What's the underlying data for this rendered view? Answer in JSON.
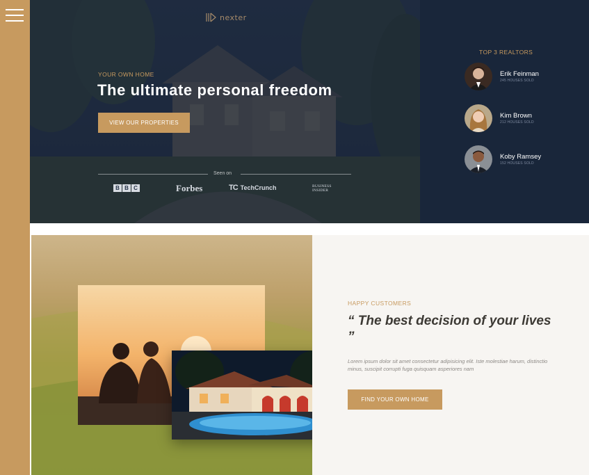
{
  "nav": {
    "menu_icon": "hamburger-menu-icon"
  },
  "brand": {
    "logo_text": "nexter"
  },
  "hero": {
    "eyebrow": "YOUR OWN HOME",
    "title": "The ultimate personal freedom",
    "cta_label": "VIEW OUR PROPERTIES",
    "seen_on_label": "Seen on",
    "press": {
      "bbc": [
        "B",
        "B",
        "C"
      ],
      "forbes": "Forbes",
      "techcrunch_mark": "TC",
      "techcrunch": "TechCrunch",
      "business_insider": [
        "BUSINESS",
        "INSIDER"
      ]
    }
  },
  "realtors": {
    "title": "TOP 3 REALTORS",
    "items": [
      {
        "name": "Erik Feinman",
        "sub": "245 HOUSES SOLD"
      },
      {
        "name": "Kim Brown",
        "sub": "212 HOUSES SOLD"
      },
      {
        "name": "Koby Ramsey",
        "sub": "152 HOUSES SOLD"
      }
    ]
  },
  "testimonial": {
    "eyebrow": "HAPPY CUSTOMERS",
    "quote": "“ The best decision of your lives ”",
    "body": "Lorem ipsum dolor sit amet consectetur adipisicing elit. Iste molestiae harum, distinctio minus, suscipit corrupti fuga quisquam asperiores nam",
    "cta_label": "FIND YOUR OWN HOME"
  },
  "colors": {
    "accent": "#c79a5f",
    "navy": "#19263a",
    "light_bg": "#f7f5f2"
  }
}
